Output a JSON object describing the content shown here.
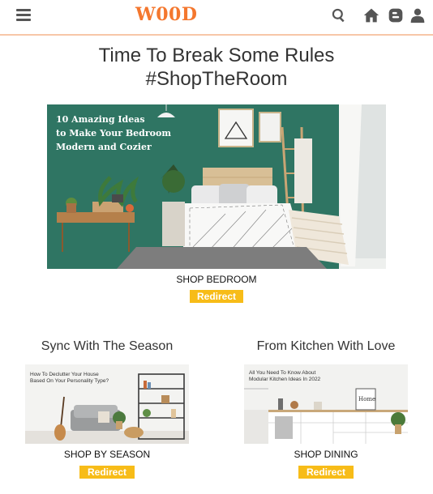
{
  "header": {
    "logo": "W00D",
    "icons": [
      "menu-icon",
      "search-icon",
      "home-icon",
      "blog-icon",
      "user-icon"
    ]
  },
  "hero": {
    "title_line1": "Time To Break Some Rules",
    "title_line2": "#ShopTheRoom",
    "image_text_line1": "10 Amazing Ideas",
    "image_text_line2": "to Make Your Bedroom",
    "image_text_line3": "Modern and Cozier",
    "shop_label": "SHOP BEDROOM",
    "button_label": "Redirect"
  },
  "sections": [
    {
      "title": "Sync With The Season",
      "image_text_line1": "How To Declutter Your House",
      "image_text_line2": "Based On Your Personality Type?",
      "shop_label": "SHOP BY SEASON",
      "button_label": "Redirect"
    },
    {
      "title": "From Kitchen With Love",
      "image_text_line1": "All You Need To Know About",
      "image_text_line2": "Modular Kitchen Ideas In 2022",
      "image_sign": "Home",
      "shop_label": "SHOP DINING",
      "button_label": "Redirect"
    }
  ],
  "colors": {
    "accent": "#f4772e",
    "button": "#f7bc18",
    "hero_wall": "#2f7563"
  }
}
